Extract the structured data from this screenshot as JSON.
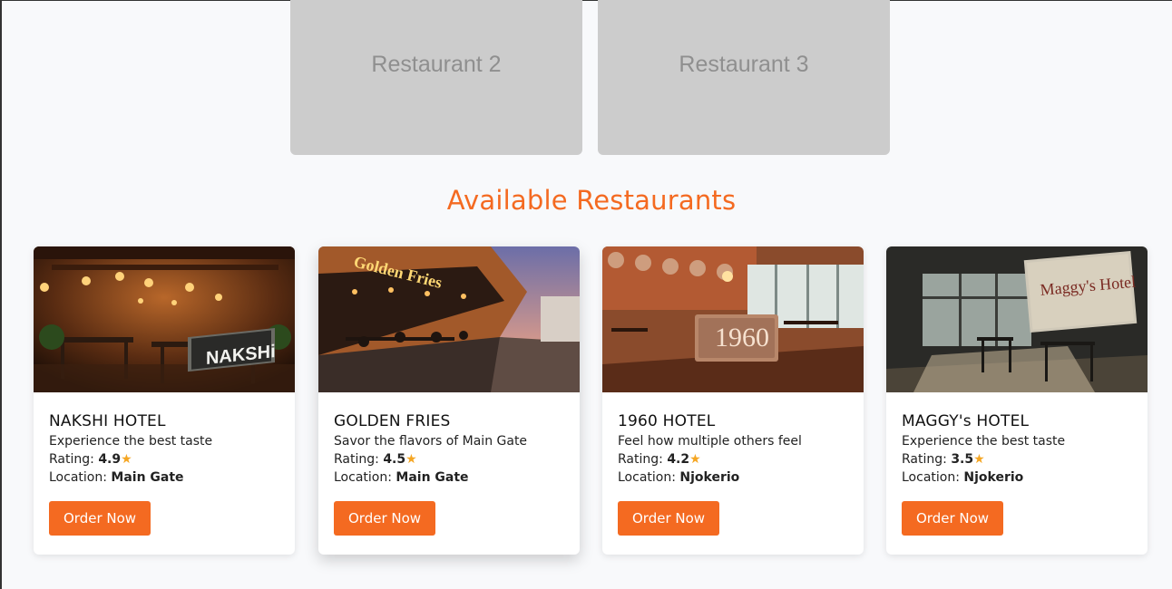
{
  "slides": [
    "Restaurant 2",
    "Restaurant 3"
  ],
  "section_title": "Available Restaurants",
  "labels": {
    "rating": "Rating:",
    "location": "Location:"
  },
  "restaurants": [
    {
      "name": "NAKSHI HOTEL",
      "tagline": "Experience the best taste",
      "rating": "4.9",
      "location": "Main Gate",
      "sign": "NAKSHi",
      "button": "Order Now"
    },
    {
      "name": "GOLDEN FRIES",
      "tagline": "Savor the flavors of Main Gate",
      "rating": "4.5",
      "location": "Main Gate",
      "sign": "Golden Fries",
      "button": "Order Now"
    },
    {
      "name": "1960 HOTEL",
      "tagline": "Feel how multiple others feel",
      "rating": "4.2",
      "location": "Njokerio",
      "sign": "1960",
      "button": "Order Now"
    },
    {
      "name": "MAGGY's HOTEL",
      "tagline": "Experience the best taste",
      "rating": "3.5",
      "location": "Njokerio",
      "sign": "Maggy's Hotel",
      "button": "Order Now"
    }
  ],
  "star_glyph": "★",
  "colors": {
    "accent": "#f46a21",
    "star": "#f5a623"
  }
}
